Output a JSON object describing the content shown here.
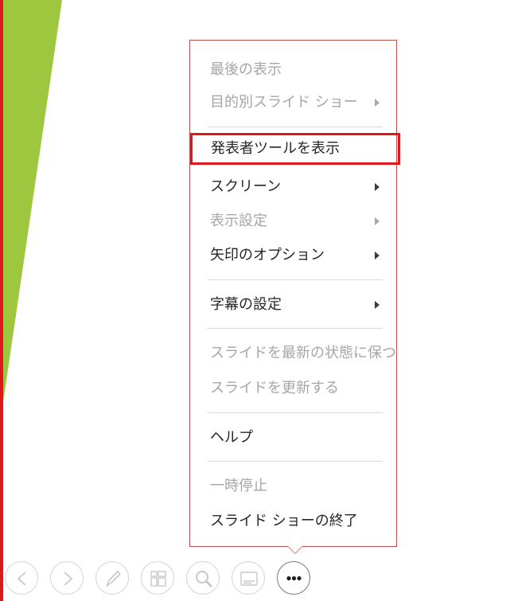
{
  "colors": {
    "accent_red": "#e0161d",
    "slide_green": "#9dc73e",
    "menu_border": "#c0504d",
    "text_enabled": "#262626",
    "text_disabled": "#a6a6a6"
  },
  "menu": {
    "items": [
      {
        "label": "最後の表示",
        "disabled": true,
        "submenu": false
      },
      {
        "label": "目的別スライド ショー",
        "disabled": true,
        "submenu": true
      },
      {
        "label": "発表者ツールを表示",
        "disabled": false,
        "submenu": false,
        "highlighted": true
      },
      {
        "label": "スクリーン",
        "disabled": false,
        "submenu": true
      },
      {
        "label": "表示設定",
        "disabled": true,
        "submenu": true
      },
      {
        "label": "矢印のオプション",
        "disabled": false,
        "submenu": true
      },
      {
        "label": "字幕の設定",
        "disabled": false,
        "submenu": true
      },
      {
        "label": "スライドを最新の状態に保つ",
        "disabled": true,
        "submenu": false
      },
      {
        "label": "スライドを更新する",
        "disabled": true,
        "submenu": false
      },
      {
        "label": "ヘルプ",
        "disabled": false,
        "submenu": false
      },
      {
        "label": "一時停止",
        "disabled": true,
        "submenu": false
      },
      {
        "label": "スライド ショーの終了",
        "disabled": false,
        "submenu": false
      }
    ]
  },
  "toolbar": {
    "buttons": [
      {
        "icon": "previous-icon"
      },
      {
        "icon": "next-icon"
      },
      {
        "icon": "pen-icon"
      },
      {
        "icon": "see-all-slides-icon"
      },
      {
        "icon": "zoom-icon"
      },
      {
        "icon": "subtitles-icon"
      },
      {
        "icon": "more-options-icon",
        "active": true
      }
    ]
  }
}
